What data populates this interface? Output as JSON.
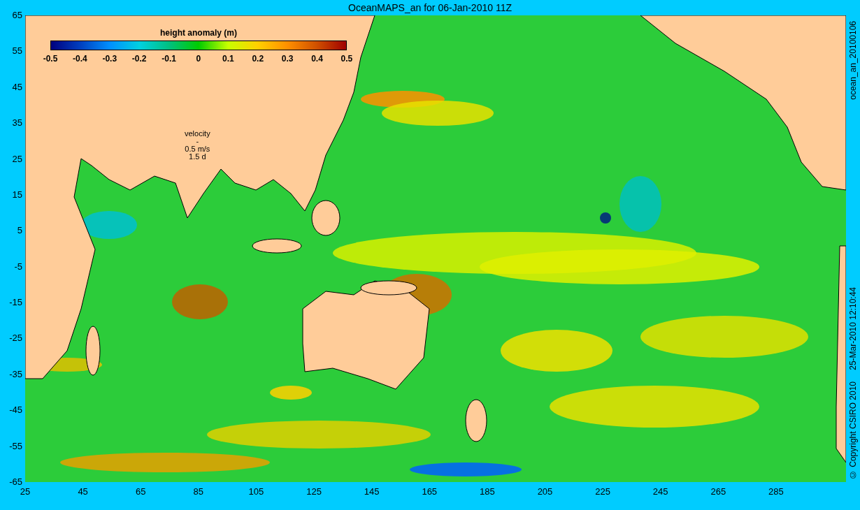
{
  "title": "OceanMAPS_an for 06-Jan-2010 11Z",
  "y_axis": {
    "ticks": [
      "65",
      "55",
      "45",
      "35",
      "25",
      "15",
      "5",
      "-5",
      "-15",
      "-25",
      "-35",
      "-45",
      "-55",
      "-65"
    ]
  },
  "x_axis": {
    "ticks": [
      "25",
      "45",
      "65",
      "85",
      "105",
      "125",
      "145",
      "165",
      "185",
      "205",
      "225",
      "245",
      "265",
      "285"
    ]
  },
  "colorbar": {
    "title": "height anomaly (m)",
    "ticks": [
      "-0.5",
      "-0.4",
      "-0.3",
      "-0.2",
      "-0.1",
      "0",
      "0.1",
      "0.2",
      "0.3",
      "0.4",
      "0.5"
    ]
  },
  "velocity_key": {
    "lines": [
      "velocity",
      "-",
      "0.5 m/s",
      "1.5 d"
    ]
  },
  "side_notes": [
    "ocean_an_20100106",
    "25-Mar-2010 12:10:44",
    "© Copyright CSIRO 2010"
  ]
}
